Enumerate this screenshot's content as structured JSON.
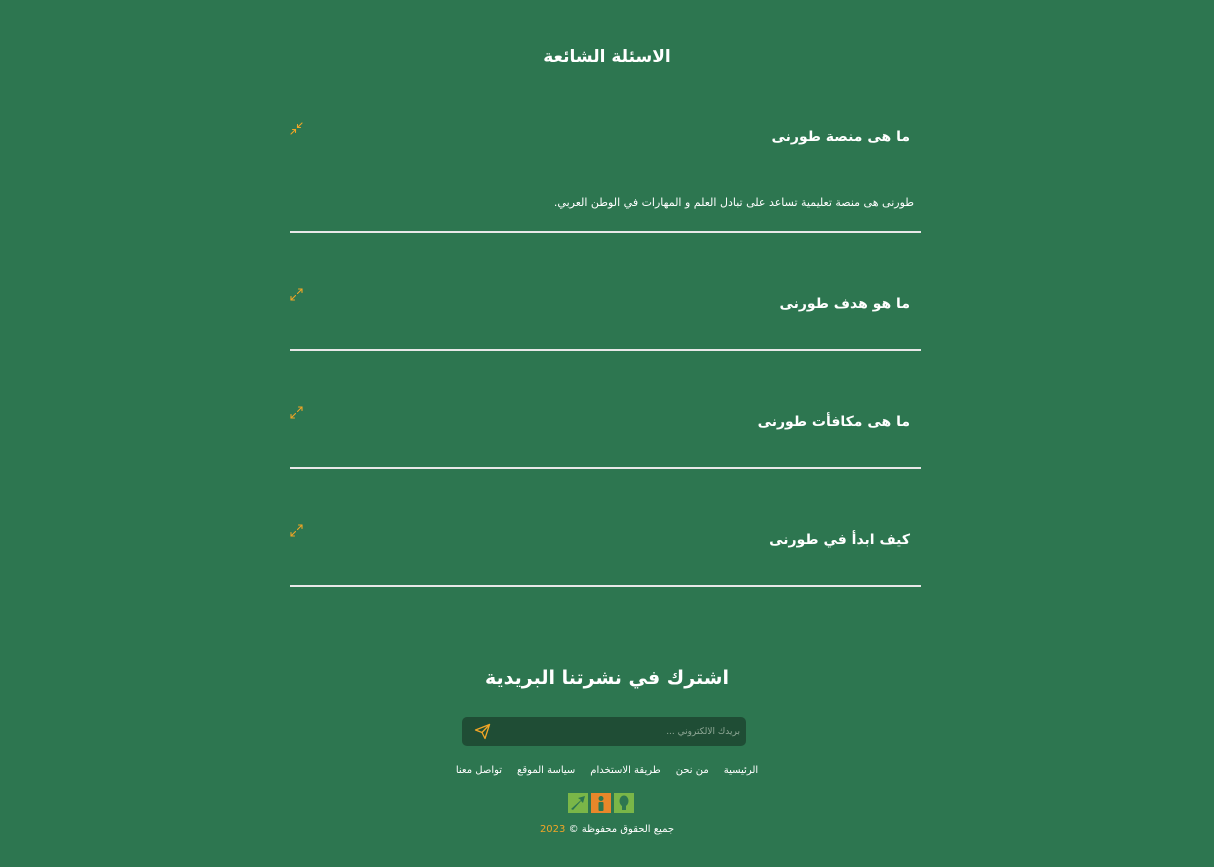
{
  "faq": {
    "title": "الاسئلة الشائعة",
    "items": [
      {
        "question": "ما هى منصة طورنى",
        "answer": "طورنى هى منصة تعليمية تساعد على تبادل العلم و المهارات في الوطن العربي.",
        "state": "expanded",
        "icon": "collapse-icon"
      },
      {
        "question": "ما هو هدف طورنى",
        "state": "collapsed",
        "icon": "expand-icon"
      },
      {
        "question": "ما هى مكافأت طورنى",
        "state": "collapsed",
        "icon": "expand-icon"
      },
      {
        "question": "كيف ابدأ في طورنى",
        "state": "collapsed",
        "icon": "expand-icon"
      }
    ]
  },
  "newsletter": {
    "title": "اشترك في نشرتنا البريدية",
    "email_placeholder": "بريدك الالكتروني ...",
    "send_icon": "paper-plane-icon"
  },
  "footer": {
    "nav": [
      "الرئيسية",
      "من نحن",
      "طريقة الاستخدام",
      "سياسة الموقع",
      "تواصل معنا"
    ],
    "social_icons": [
      "logo-green-arrow-icon",
      "logo-orange-person-icon",
      "logo-green-bulb-icon"
    ],
    "copyright_text": "جميع الحقوق محفوظة ©",
    "copyright_year": "2023"
  },
  "colors": {
    "background": "#2d7650",
    "input_background": "#1f4d35",
    "accent": "#f0a526",
    "divider": "#e8e8e8",
    "text": "#ffffff"
  }
}
